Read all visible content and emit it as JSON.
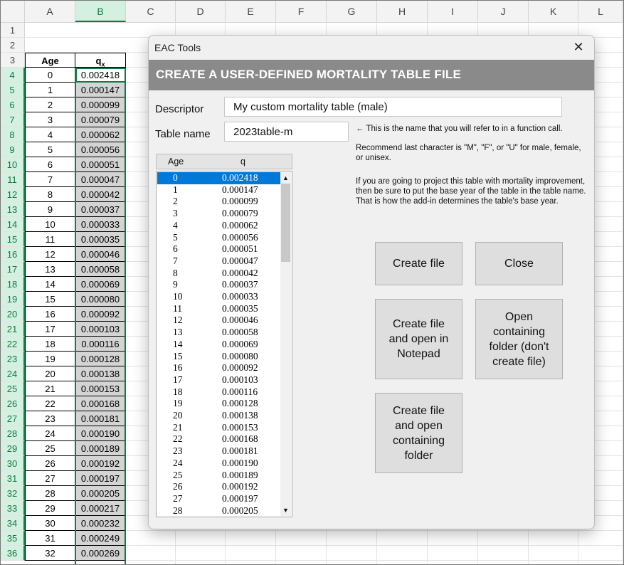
{
  "sheet": {
    "columns": [
      "A",
      "B",
      "C",
      "D",
      "E",
      "F",
      "G",
      "H",
      "I",
      "J",
      "K",
      "L"
    ],
    "rows": [
      "1",
      "2",
      "3",
      "4",
      "5",
      "6",
      "7",
      "8",
      "9",
      "10",
      "11",
      "12",
      "13",
      "14",
      "15",
      "16",
      "17",
      "18",
      "19",
      "20",
      "21",
      "22",
      "23",
      "24",
      "25",
      "26",
      "27",
      "28",
      "29",
      "30",
      "31",
      "32",
      "33",
      "34",
      "35",
      "36"
    ],
    "header_age": "Age",
    "header_q": "q",
    "header_q_sub": "x",
    "data": [
      [
        "0",
        "0.002418"
      ],
      [
        "1",
        "0.000147"
      ],
      [
        "2",
        "0.000099"
      ],
      [
        "3",
        "0.000079"
      ],
      [
        "4",
        "0.000062"
      ],
      [
        "5",
        "0.000056"
      ],
      [
        "6",
        "0.000051"
      ],
      [
        "7",
        "0.000047"
      ],
      [
        "8",
        "0.000042"
      ],
      [
        "9",
        "0.000037"
      ],
      [
        "10",
        "0.000033"
      ],
      [
        "11",
        "0.000035"
      ],
      [
        "12",
        "0.000046"
      ],
      [
        "13",
        "0.000058"
      ],
      [
        "14",
        "0.000069"
      ],
      [
        "15",
        "0.000080"
      ],
      [
        "16",
        "0.000092"
      ],
      [
        "17",
        "0.000103"
      ],
      [
        "18",
        "0.000116"
      ],
      [
        "19",
        "0.000128"
      ],
      [
        "20",
        "0.000138"
      ],
      [
        "21",
        "0.000153"
      ],
      [
        "22",
        "0.000168"
      ],
      [
        "23",
        "0.000181"
      ],
      [
        "24",
        "0.000190"
      ],
      [
        "25",
        "0.000189"
      ],
      [
        "26",
        "0.000192"
      ],
      [
        "27",
        "0.000197"
      ],
      [
        "28",
        "0.000205"
      ],
      [
        "29",
        "0.000217"
      ],
      [
        "30",
        "0.000232"
      ],
      [
        "31",
        "0.000249"
      ],
      [
        "32",
        "0.000269"
      ]
    ],
    "colors": {
      "selection": "#107c41",
      "selected_header_bg": "#d3f0e0",
      "cell_fill": "#d4d4d4"
    }
  },
  "dialog": {
    "title": "EAC Tools",
    "close_glyph": "✕",
    "banner": "CREATE A USER-DEFINED MORTALITY TABLE FILE",
    "banner_color": "#8a8a8a",
    "descriptor_label": "Descriptor",
    "descriptor_value": "My custom mortality table (male)",
    "table_name_label": "Table name",
    "table_name_value": "2023table-m",
    "note1": "← This is the name that you will refer to in a function call.",
    "note2": "Recommend last character is \"M\", \"F\", or \"U\" for male, female, or unisex.",
    "note3": "If you are going to project this table with mortality improvement, then be sure to put the base year of the table in the table name. That is how the add-in determines the table's base year.",
    "list_header_age": "Age",
    "list_header_q": "q",
    "list_rows": [
      [
        "0",
        "0.002418"
      ],
      [
        "1",
        "0.000147"
      ],
      [
        "2",
        "0.000099"
      ],
      [
        "3",
        "0.000079"
      ],
      [
        "4",
        "0.000062"
      ],
      [
        "5",
        "0.000056"
      ],
      [
        "6",
        "0.000051"
      ],
      [
        "7",
        "0.000047"
      ],
      [
        "8",
        "0.000042"
      ],
      [
        "9",
        "0.000037"
      ],
      [
        "10",
        "0.000033"
      ],
      [
        "11",
        "0.000035"
      ],
      [
        "12",
        "0.000046"
      ],
      [
        "13",
        "0.000058"
      ],
      [
        "14",
        "0.000069"
      ],
      [
        "15",
        "0.000080"
      ],
      [
        "16",
        "0.000092"
      ],
      [
        "17",
        "0.000103"
      ],
      [
        "18",
        "0.000116"
      ],
      [
        "19",
        "0.000128"
      ],
      [
        "20",
        "0.000138"
      ],
      [
        "21",
        "0.000153"
      ],
      [
        "22",
        "0.000168"
      ],
      [
        "23",
        "0.000181"
      ],
      [
        "24",
        "0.000190"
      ],
      [
        "25",
        "0.000189"
      ],
      [
        "26",
        "0.000192"
      ],
      [
        "27",
        "0.000197"
      ],
      [
        "28",
        "0.000205"
      ]
    ],
    "scroll_up_glyph": "▲",
    "scroll_down_glyph": "▼",
    "buttons": {
      "create_file": "Create file",
      "close": "Close",
      "create_open_notepad": "Create file\nand open in\nNotepad",
      "open_folder": "Open\ncontaining\nfolder (don't\ncreate file)",
      "create_open_folder": "Create file\nand open\ncontaining\nfolder"
    },
    "selection_color": "#0078d7"
  }
}
